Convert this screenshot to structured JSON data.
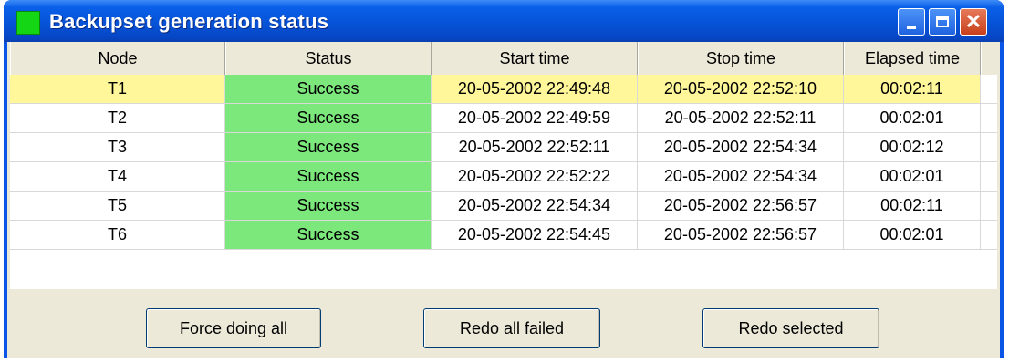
{
  "window": {
    "title": "Backupset generation status",
    "close_glyph": "✕"
  },
  "table": {
    "columns": [
      "Node",
      "Status",
      "Start time",
      "Stop time",
      "Elapsed time"
    ],
    "rows": [
      {
        "node": "T1",
        "status": "Success",
        "start": "20-05-2002 22:49:48",
        "stop": "20-05-2002 22:52:10",
        "elapsed": "00:02:11"
      },
      {
        "node": "T2",
        "status": "Success",
        "start": "20-05-2002 22:49:59",
        "stop": "20-05-2002 22:52:11",
        "elapsed": "00:02:01"
      },
      {
        "node": "T3",
        "status": "Success",
        "start": "20-05-2002 22:52:11",
        "stop": "20-05-2002 22:54:34",
        "elapsed": "00:02:12"
      },
      {
        "node": "T4",
        "status": "Success",
        "start": "20-05-2002 22:52:22",
        "stop": "20-05-2002 22:54:34",
        "elapsed": "00:02:01"
      },
      {
        "node": "T5",
        "status": "Success",
        "start": "20-05-2002 22:54:34",
        "stop": "20-05-2002 22:56:57",
        "elapsed": "00:02:11"
      },
      {
        "node": "T6",
        "status": "Success",
        "start": "20-05-2002 22:54:45",
        "stop": "20-05-2002 22:56:57",
        "elapsed": "00:02:01"
      }
    ]
  },
  "buttons": {
    "force_all": "Force doing all",
    "redo_failed": "Redo all failed",
    "redo_selected": "Redo selected"
  },
  "colors": {
    "title_bar": "#0653d8",
    "status_success": "#7ce87c",
    "selected_row": "#fff79a",
    "app_icon": "#15d615"
  },
  "icons": {
    "app": "green-square-icon",
    "minimize": "minimize-icon",
    "maximize": "maximize-icon",
    "close": "close-icon"
  }
}
